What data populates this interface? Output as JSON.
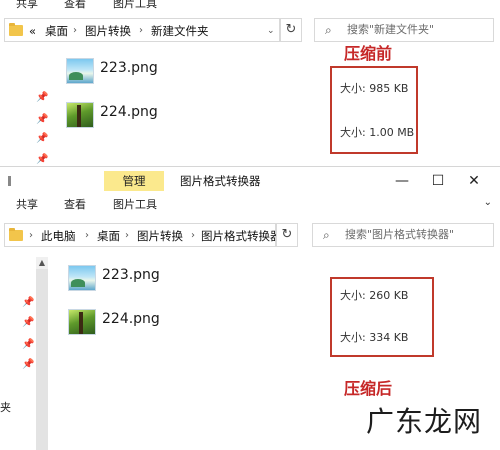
{
  "top_window": {
    "ribbon_tabs": [
      "共享",
      "查看",
      "图片工具"
    ],
    "breadcrumb": [
      "«",
      "桌面",
      "图片转换",
      "新建文件夹"
    ],
    "search_placeholder": "搜索\"新建文件夹\"",
    "files": [
      {
        "name": "223.png",
        "size": "大小: 985 KB",
        "thumb": "sky-landscape"
      },
      {
        "name": "224.png",
        "size": "大小: 1.00 MB",
        "thumb": "green-forest"
      }
    ],
    "annotation": "压缩前"
  },
  "bottom_window": {
    "manage_tab": "管理",
    "title": "图片格式转换器",
    "ribbon_tabs": [
      "共享",
      "查看",
      "图片工具"
    ],
    "breadcrumb": [
      "此电脑",
      "桌面",
      "图片转换",
      "图片格式转换器"
    ],
    "search_placeholder": "搜索\"图片格式转换器\"",
    "files": [
      {
        "name": "223.png",
        "size": "大小: 260 KB",
        "thumb": "sky-landscape"
      },
      {
        "name": "224.png",
        "size": "大小: 334 KB",
        "thumb": "green-forest"
      }
    ],
    "annotation": "压缩后",
    "nav_fragment": "夹"
  },
  "watermark": "广东龙网",
  "colors": {
    "annotation_red": "#c62828",
    "manage_tab_bg": "#fbe98d",
    "folder": "#f2c54b"
  }
}
